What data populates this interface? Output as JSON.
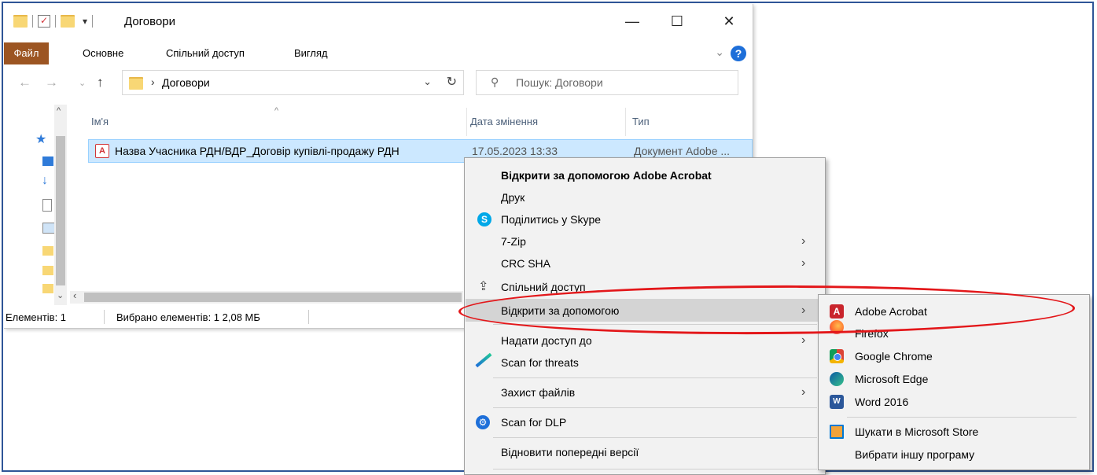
{
  "window": {
    "title": "Договори",
    "buttons": [
      "—",
      "☐",
      "✕"
    ]
  },
  "ribbon": {
    "tabs": [
      "Файл",
      "Основне",
      "Спільний доступ",
      "Вигляд"
    ],
    "help": "?"
  },
  "nav": {
    "path": "Договори",
    "search_placeholder": "Пошук: Договори"
  },
  "columns": {
    "name": "Ім'я",
    "date": "Дата змінення",
    "type": "Тип"
  },
  "file": {
    "name": "Назва Учасника РДН/ВДР_Договір купівлі-продажу РДН",
    "date": "17.05.2023 13:33",
    "type": "Документ Adobe ..."
  },
  "status": {
    "items": "Елементів: 1",
    "selected": "Вибрано елементів: 1  2,08 МБ"
  },
  "context_menu": {
    "open_with_acrobat": "Відкрити за допомогою Adobe Acrobat",
    "print": "Друк",
    "share_skype": "Поділитись у Skype",
    "zip": "7-Zip",
    "crc": "CRC SHA",
    "share": "Спільний доступ",
    "open_with": "Відкрити за допомогою",
    "give_access": "Надати доступ до",
    "scan_threats": "Scan for threats",
    "protect": "Захист файлів",
    "scan_dlp": "Scan for DLP",
    "restore": "Відновити попередні версії"
  },
  "submenu": {
    "items": [
      "Adobe Acrobat",
      "Firefox",
      "Google Chrome",
      "Microsoft Edge",
      "Word 2016"
    ],
    "store": "Шукати в Microsoft Store",
    "choose": "Вибрати іншу програму"
  },
  "colors": {
    "file_tab": "#9c5522",
    "selection": "#cce8ff",
    "annotation": "#e3171a",
    "frame": "#2f5597"
  }
}
